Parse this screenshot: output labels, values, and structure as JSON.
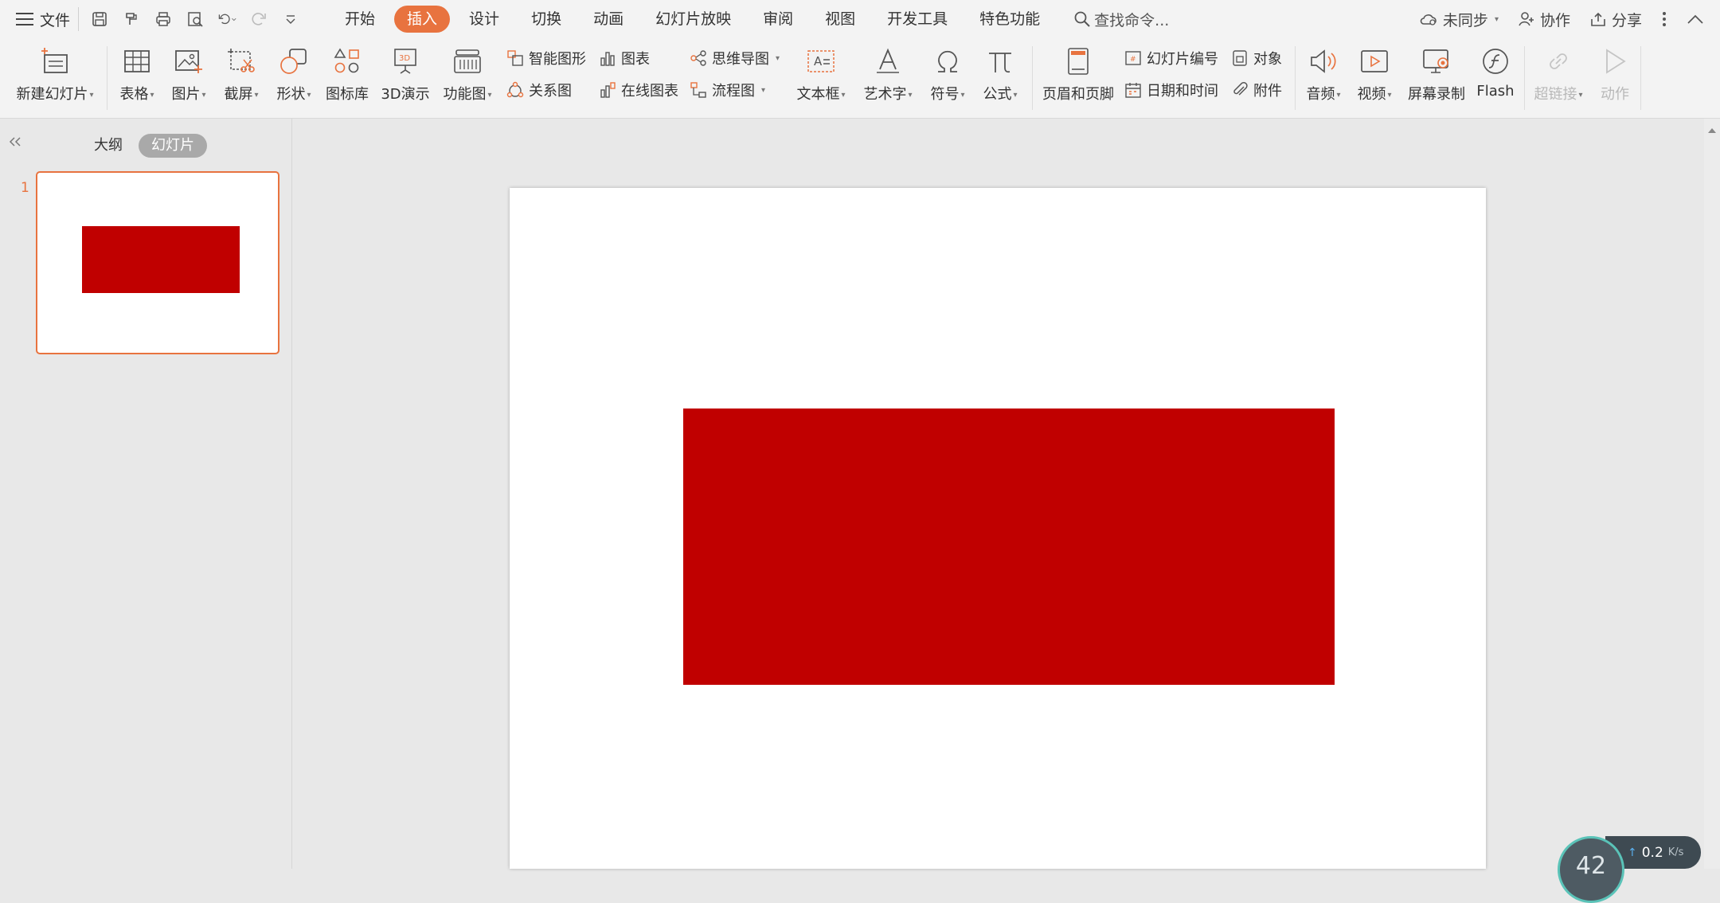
{
  "app": {
    "file_menu_label": "文件",
    "accent_color": "#e8733f",
    "shape_color": "#c00000"
  },
  "tabs": [
    {
      "label": "开始"
    },
    {
      "label": "插入",
      "active": true
    },
    {
      "label": "设计"
    },
    {
      "label": "切换"
    },
    {
      "label": "动画"
    },
    {
      "label": "幻灯片放映"
    },
    {
      "label": "审阅"
    },
    {
      "label": "视图"
    },
    {
      "label": "开发工具"
    },
    {
      "label": "特色功能"
    }
  ],
  "search": {
    "placeholder": "查找命令..."
  },
  "right_tools": {
    "sync_label": "未同步",
    "collab_label": "协作",
    "share_label": "分享"
  },
  "ribbon": {
    "new_slide": "新建幻灯片",
    "table": "表格",
    "picture": "图片",
    "screenshot": "截屏",
    "shape": "形状",
    "icon_library": "图标库",
    "demo_3d": "3D演示",
    "function_chart": "功能图",
    "smart_art": "智能图形",
    "relation_chart": "关系图",
    "chart": "图表",
    "online_chart": "在线图表",
    "mind_map": "思维导图",
    "flowchart": "流程图",
    "text_box": "文本框",
    "word_art": "艺术字",
    "symbol": "符号",
    "formula": "公式",
    "header_footer": "页眉和页脚",
    "slide_number": "幻灯片编号",
    "date_time": "日期和时间",
    "object": "对象",
    "attachment": "附件",
    "audio": "音频",
    "video": "视频",
    "screen_record": "屏幕录制",
    "flash": "Flash",
    "hyperlink": "超链接",
    "action": "动作"
  },
  "left_pane": {
    "outline_tab": "大纲",
    "slides_tab": "幻灯片",
    "slide_numbers": [
      "1"
    ]
  },
  "net_widget": {
    "percent": "42",
    "speed": "0.2",
    "unit": "K/s"
  }
}
